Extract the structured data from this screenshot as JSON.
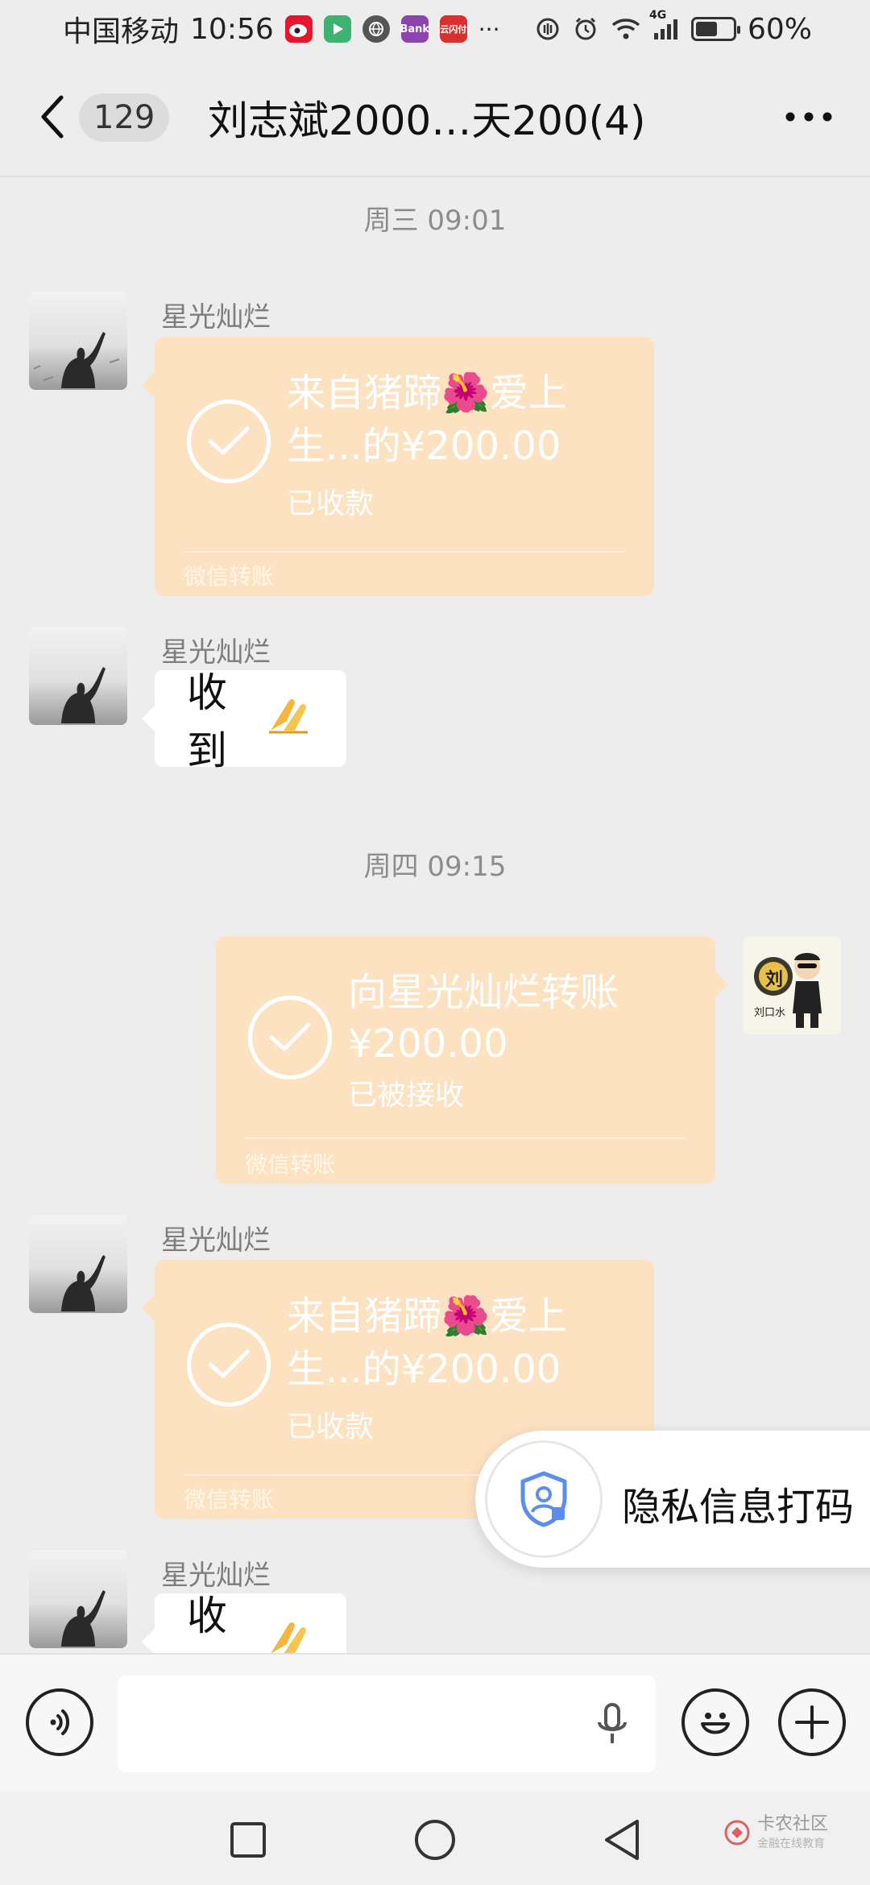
{
  "status_bar": {
    "carrier": "中国移动",
    "time": "10:56",
    "battery_percent": "60%",
    "battery_level": 0.6,
    "network_label": "4G",
    "app_icons": [
      "weibo-icon",
      "video-app-icon",
      "browser-icon",
      "bank-app-icon",
      "pay-app-icon"
    ],
    "app_icon_texts": [
      "Bank",
      "云闪付"
    ],
    "more": "···"
  },
  "header": {
    "unread_count": "129",
    "title": "刘志斌2000…天200(4)"
  },
  "messages": {
    "ts1": "周三 09:01",
    "ts2": "周四 09:15",
    "sender": "星光灿烂",
    "transfer_in_1": {
      "line1": "来自猪蹄🌺爱上",
      "line2": "生...的¥200.00",
      "status": "已收款",
      "footer": "微信转账"
    },
    "text_1": "收到",
    "transfer_out": {
      "line1": "向星光灿烂转账",
      "line2": "¥200.00",
      "status": "已被接收",
      "footer": "微信转账"
    },
    "transfer_in_2": {
      "line1": "来自猪蹄🌺爱上",
      "line2": "生...的¥200.00",
      "status": "已收款",
      "footer": "微信转账"
    },
    "text_2": "收到"
  },
  "my_avatar": {
    "char": "刘",
    "caption": "刘口水"
  },
  "privacy_popup": {
    "label": "隐私信息打码"
  },
  "input_bar": {
    "value": "",
    "placeholder": ""
  },
  "watermark": {
    "title": "卡农社区",
    "subtitle": "金融在线教育"
  },
  "colors": {
    "background": "#ededed",
    "transfer_bubble": "#fde2c2",
    "privacy_icon": "#5b8def"
  }
}
